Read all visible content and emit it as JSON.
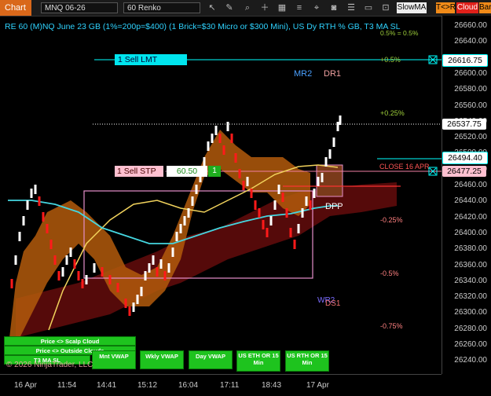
{
  "toolbar": {
    "chart_tab": "Chart",
    "instrument": "MNQ 06-26",
    "timeframe": "60 Renko",
    "indicator": "SlowMA",
    "tr_button": "T<>R",
    "cloud_button": "Cloud",
    "bar_button": "Bar"
  },
  "title": "RE 60 (M)NQ June 23 GB (1%=200p=$400) (1 Brick=$30 Micro or $300 Mini), US Dy RTH % GB, T3 MA SL",
  "overlay_title": "0.5% = 0.5%",
  "orders": {
    "sell_lmt": "1 Sell LMT",
    "sell_stp": "1 Sell STP",
    "stp_value": "60.50",
    "stp_qty": "1",
    "close_label": "CLOSE 16 APR"
  },
  "labels": {
    "mr2": "MR2",
    "dr1": "DR1",
    "dpp": "DPP",
    "wr2": "WR2",
    "ds1": "DS1",
    "pct_p050": "+0.5%",
    "pct_p025": "+0.25%",
    "pct_m025": "-0.25%",
    "pct_m05": "-0.5%",
    "pct_m075": "-0.75%"
  },
  "price_ticks": [
    "26660.00",
    "26640.00",
    "26620.00",
    "26600.00",
    "26580.00",
    "26560.00",
    "26540.00",
    "26520.00",
    "26500.00",
    "26480.00",
    "26460.00",
    "26440.00",
    "26420.00",
    "26400.00",
    "26380.00",
    "26360.00",
    "26340.00",
    "26320.00",
    "26300.00",
    "26280.00",
    "26260.00",
    "26240.00"
  ],
  "price_tags": {
    "sell_lmt": "26616.75",
    "last": "26537.75",
    "bid": "26494.40",
    "stop": "26477.25"
  },
  "time_labels": [
    "16 Apr",
    "11:54",
    "14:41",
    "15:12",
    "16:04",
    "17:11",
    "18:43",
    "17 Apr"
  ],
  "buttons": {
    "price_scalp": "Price <> Scalp Cloud",
    "price_outside": "Price <> Outside Clouds",
    "t3_ma": "T3 MA SL",
    "mnt_vwap": "Mnt VWAP",
    "wkly_vwap": "Wkly VWAP",
    "day_vwap": "Day VWAP",
    "us_eth": "US ETH OR 15 Min",
    "us_rth": "US RTH OR 15 Min"
  },
  "copyright": "© 2026 NinjaTrader, LLC",
  "colors": {
    "accent": "#d9681a",
    "title": "#2fd3ff",
    "up_brick": "#ffffff",
    "down_brick": "#ff1a1a",
    "cloud_orange": "#c0660f",
    "cloud_red": "#8a0f0f",
    "ma_yellow": "#f2d35c",
    "ma_cyan": "#44d6e0",
    "box_pink": "#e58fcb",
    "order_cyan": "#00ffff"
  }
}
